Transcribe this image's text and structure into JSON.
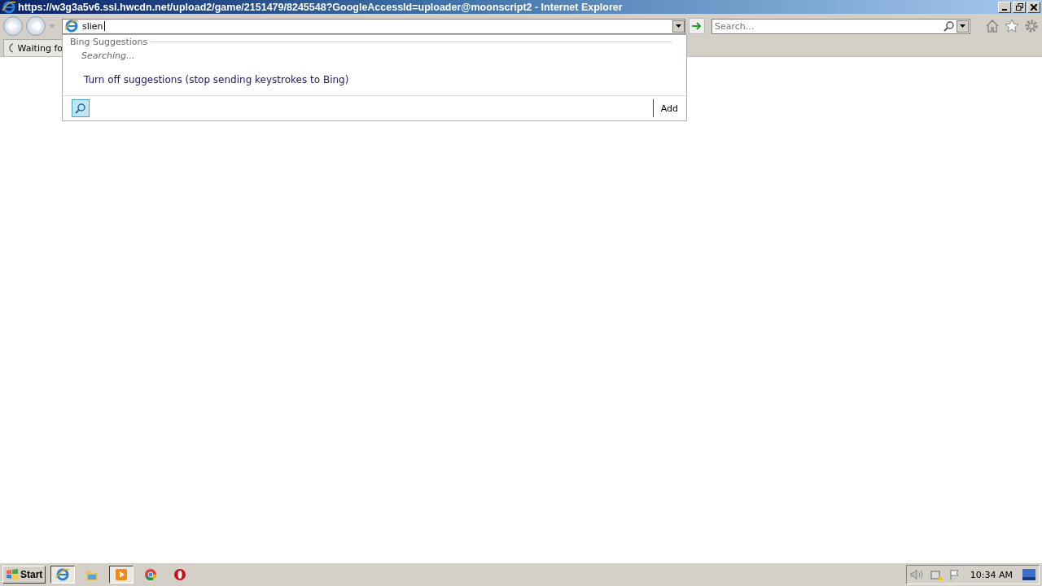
{
  "window": {
    "title": "https://w3g3a5v6.ssl.hwcdn.net/upload2/game/2151479/8245548?GoogleAccessId=uploader@moonscript2 - Internet Explorer"
  },
  "address_bar": {
    "value": "slien"
  },
  "search": {
    "placeholder": "Search..."
  },
  "tab": {
    "label": "Waiting fo"
  },
  "suggestions": {
    "heading": "Bing Suggestions",
    "status": "Searching...",
    "turn_off": "Turn off suggestions (stop sending keystrokes to Bing)",
    "add": "Add"
  },
  "taskbar": {
    "start": "Start",
    "items": [
      {
        "kind": "ie",
        "selected": true
      },
      {
        "kind": "folder",
        "selected": false
      },
      {
        "kind": "media",
        "selected": true
      },
      {
        "kind": "chrome",
        "selected": false
      },
      {
        "kind": "opera",
        "selected": false
      }
    ],
    "clock": "10:34 AM"
  }
}
